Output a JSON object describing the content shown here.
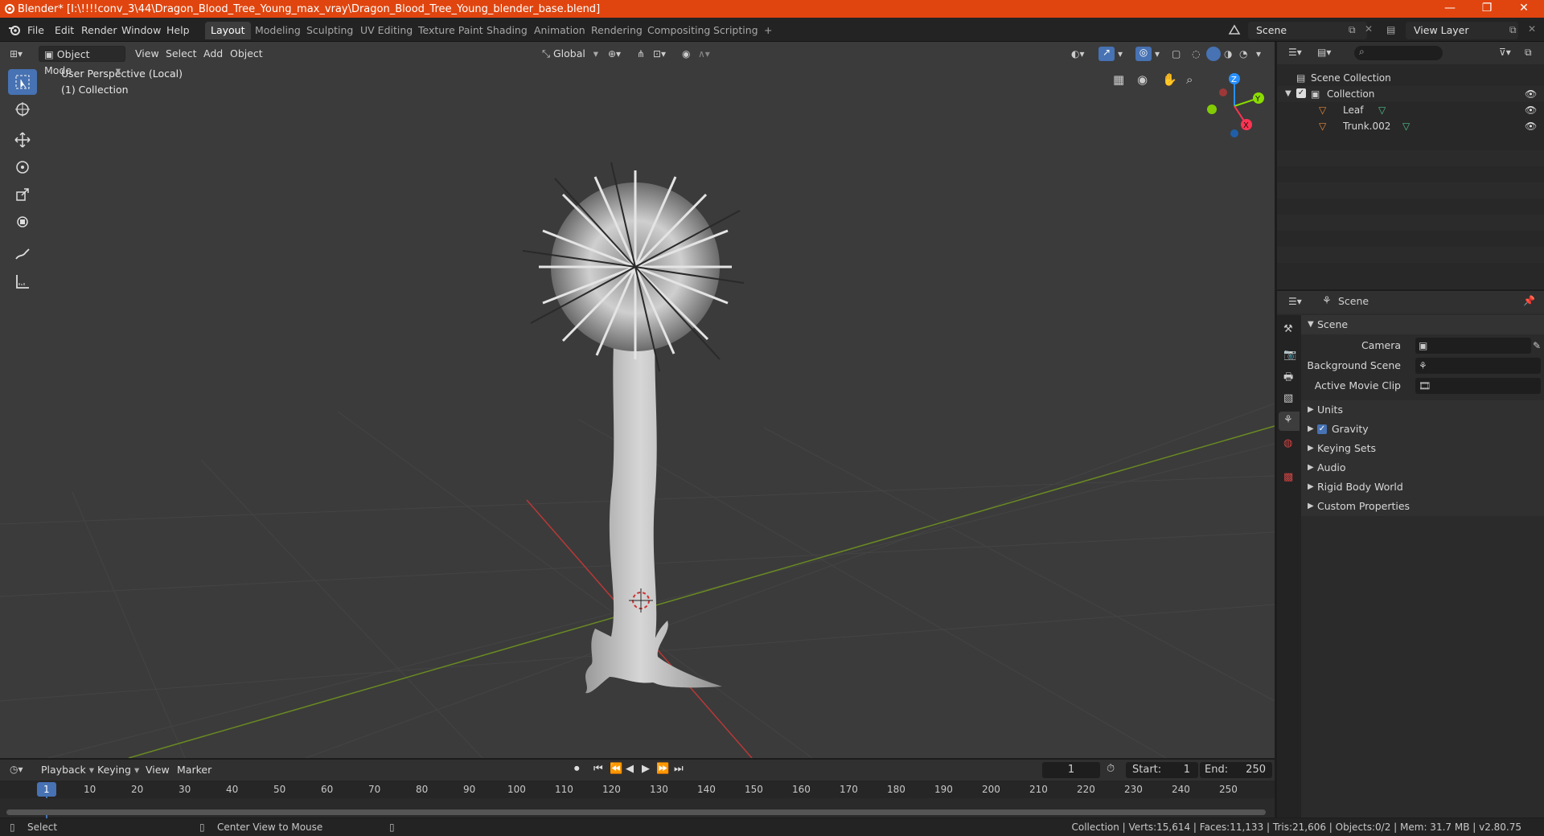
{
  "window": {
    "title": "Blender* [I:\\!!!!conv_3\\44\\Dragon_Blood_Tree_Young_max_vray\\Dragon_Blood_Tree_Young_blender_base.blend]",
    "controls": [
      "—",
      "❐",
      "✕"
    ]
  },
  "menu": {
    "items": [
      "File",
      "Edit",
      "Render",
      "Window",
      "Help"
    ]
  },
  "workspaces": {
    "tabs": [
      "Layout",
      "Modeling",
      "Sculpting",
      "UV Editing",
      "Texture Paint",
      "Shading",
      "Animation",
      "Rendering",
      "Compositing",
      "Scripting"
    ],
    "active": "Layout",
    "add": "+"
  },
  "scene_selector": {
    "value": "Scene"
  },
  "view_layer_selector": {
    "value": "View Layer"
  },
  "viewport_header": {
    "mode": "Object Mode",
    "menus": [
      "View",
      "Select",
      "Add",
      "Object"
    ],
    "orientation": "Global"
  },
  "viewport": {
    "perspective_label": "User Perspective (Local)",
    "collection_label": "(1) Collection",
    "gizmo": {
      "x": "X",
      "y": "Y",
      "z": "Z"
    }
  },
  "outliner": {
    "search_placeholder": "",
    "rows": [
      {
        "label": "Scene Collection"
      },
      {
        "label": "Collection"
      },
      {
        "label": "Leaf"
      },
      {
        "label": "Trunk.002"
      }
    ]
  },
  "properties": {
    "context": "Scene",
    "panel_title": "Scene",
    "fields": [
      {
        "label": "Camera",
        "value": ""
      },
      {
        "label": "Background Scene",
        "value": ""
      },
      {
        "label": "Active Movie Clip",
        "value": ""
      }
    ],
    "subpanels": [
      "Units",
      "Gravity",
      "Keying Sets",
      "Audio",
      "Rigid Body World",
      "Custom Properties"
    ]
  },
  "timeline": {
    "menus": [
      "Playback",
      "Keying",
      "View",
      "Marker"
    ],
    "current_frame": "1",
    "start_label": "Start:",
    "start": "1",
    "end_label": "End:",
    "end": "250",
    "ruler": [
      "1",
      "10",
      "20",
      "30",
      "40",
      "50",
      "60",
      "70",
      "80",
      "90",
      "100",
      "110",
      "120",
      "130",
      "140",
      "150",
      "160",
      "170",
      "180",
      "190",
      "200",
      "210",
      "220",
      "230",
      "240",
      "250"
    ]
  },
  "statusbar": {
    "left_action": "Select",
    "middle_action": "Center View to Mouse",
    "stats": "Collection | Verts:15,614 | Faces:11,133 | Tris:21,606 | Objects:0/2 | Mem: 31.7 MB | v2.80.75"
  },
  "colors": {
    "title_bar": "#e0450f",
    "active_tool": "#4772b3",
    "x_axis": "#ff3352",
    "y_axis": "#8bdc00",
    "z_axis": "#2890ff",
    "object_icon": "#e8883a",
    "mesh_icon": "#4fc08d"
  }
}
